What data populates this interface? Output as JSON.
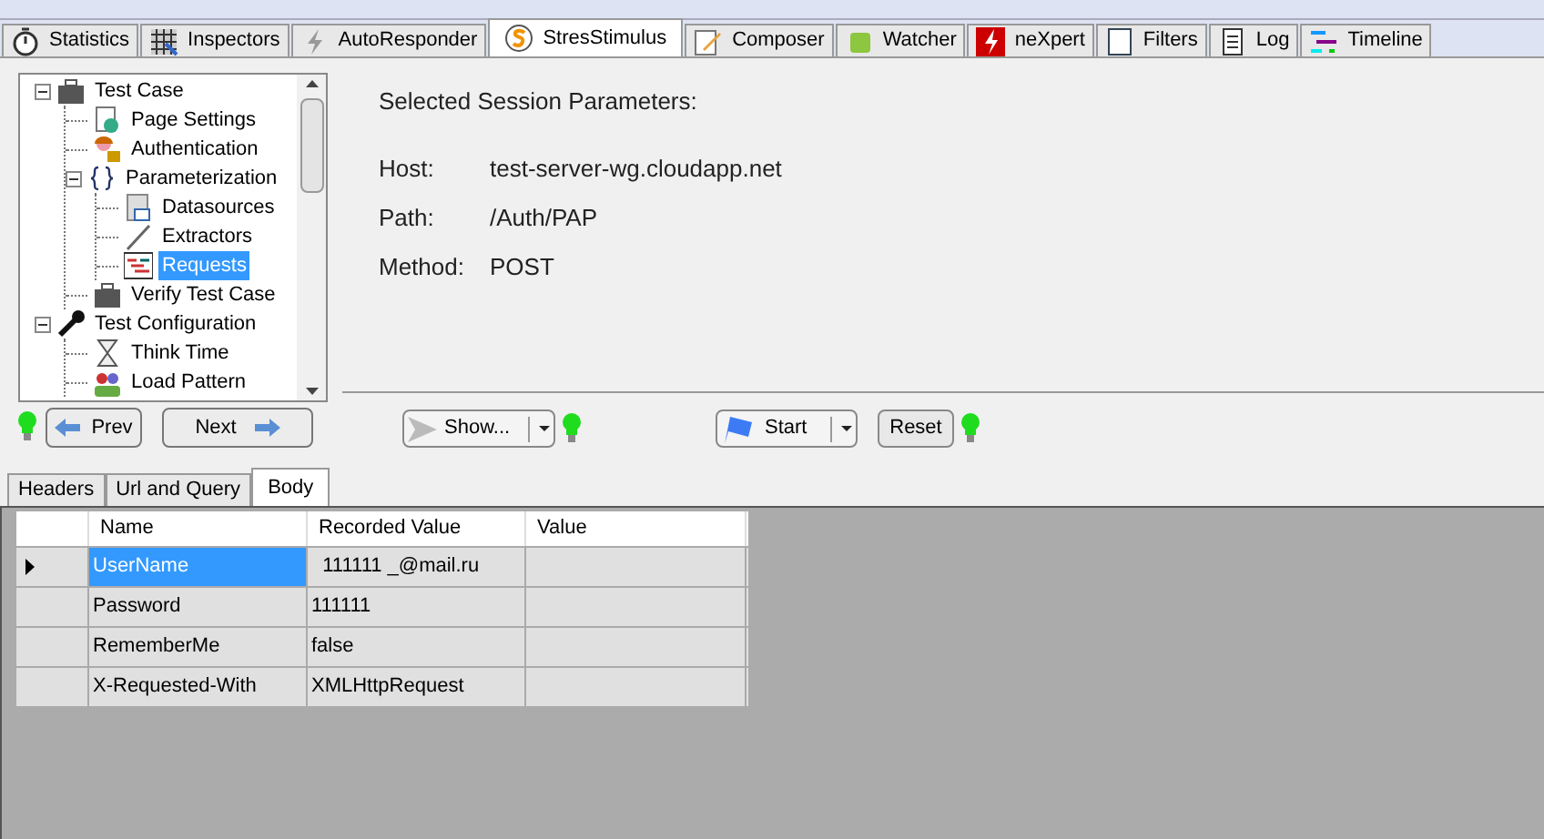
{
  "tabs": [
    {
      "label": "Statistics",
      "selected": false
    },
    {
      "label": "Inspectors",
      "selected": false
    },
    {
      "label": "AutoResponder",
      "selected": false
    },
    {
      "label": "StresStimulus",
      "selected": true
    },
    {
      "label": "Composer",
      "selected": false
    },
    {
      "label": "Watcher",
      "selected": false
    },
    {
      "label": "neXpert",
      "selected": false
    },
    {
      "label": "Filters",
      "selected": false
    },
    {
      "label": "Log",
      "selected": false
    },
    {
      "label": "Timeline",
      "selected": false
    }
  ],
  "tree": [
    {
      "label": "Test Case",
      "selected": false,
      "expanded": true,
      "children": [
        {
          "label": "Page Settings",
          "selected": false
        },
        {
          "label": "Authentication",
          "selected": false
        },
        {
          "label": "Parameterization",
          "selected": false,
          "expanded": true,
          "children": [
            {
              "label": "Datasources",
              "selected": false
            },
            {
              "label": "Extractors",
              "selected": false
            },
            {
              "label": "Requests",
              "selected": true
            }
          ]
        },
        {
          "label": "Verify Test Case",
          "selected": false
        }
      ]
    },
    {
      "label": "Test Configuration",
      "selected": false,
      "expanded": true,
      "children": [
        {
          "label": "Think Time",
          "selected": false
        },
        {
          "label": "Load Pattern",
          "selected": false
        }
      ]
    }
  ],
  "nav": {
    "prev": "Prev",
    "next": "Next"
  },
  "params": {
    "title": "Selected Session Parameters:",
    "fields": [
      {
        "label": "Host:",
        "value": "test-server-wg.cloudapp.net"
      },
      {
        "label": "Path:",
        "value": "/Auth/PAP"
      },
      {
        "label": "Method:",
        "value": "POST"
      }
    ]
  },
  "toolbar": {
    "show": "Show...",
    "start": "Start",
    "reset": "Reset"
  },
  "sub_tabs": [
    {
      "label": "Headers",
      "selected": false
    },
    {
      "label": "Url and Query",
      "selected": false
    },
    {
      "label": "Body",
      "selected": true
    }
  ],
  "grid": {
    "columns": [
      "Name",
      "Recorded Value",
      "Value"
    ],
    "rows": [
      {
        "selected": true,
        "cells": [
          "UserName",
          "  111111 _@mail.ru"
        ]
      },
      {
        "selected": false,
        "cells": [
          "Password",
          "111111"
        ]
      },
      {
        "selected": false,
        "cells": [
          "RememberMe",
          "false"
        ]
      },
      {
        "selected": false,
        "cells": [
          "X-Requested-With",
          "XMLHttpRequest"
        ]
      }
    ]
  }
}
